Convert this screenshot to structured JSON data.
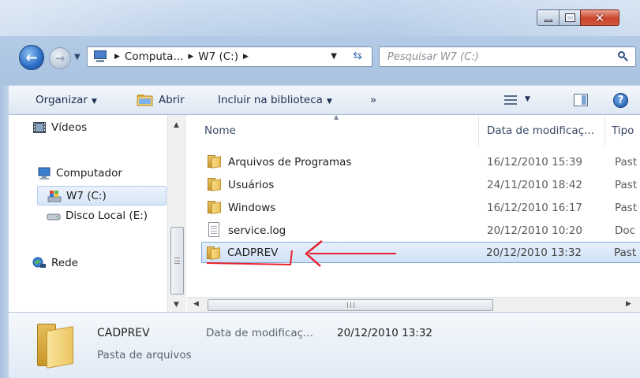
{
  "address": {
    "crumbs": [
      "Computa...",
      "W7 (C:)"
    ],
    "search_placeholder": "Pesquisar W7 (C:)"
  },
  "toolbar": {
    "organize": "Organizar",
    "open": "Abrir",
    "include": "Incluir na biblioteca",
    "more": "»"
  },
  "nav": {
    "videos": "Vídeos",
    "computer": "Computador",
    "w7": "W7 (C:)",
    "local_disk": "Disco Local (E:)",
    "network": "Rede"
  },
  "columns": {
    "name": "Nome",
    "date": "Data de modificaç...",
    "type": "Tipo"
  },
  "files": [
    {
      "name": "Arquivos de Programas",
      "date": "16/12/2010 15:39",
      "type": "Past",
      "icon": "folder"
    },
    {
      "name": "Usuários",
      "date": "24/11/2010 18:42",
      "type": "Past",
      "icon": "folder"
    },
    {
      "name": "Windows",
      "date": "16/12/2010 16:17",
      "type": "Past",
      "icon": "folder"
    },
    {
      "name": "service.log",
      "date": "20/12/2010 10:20",
      "type": "Doc",
      "icon": "document"
    },
    {
      "name": "CADPREV",
      "date": "20/12/2010 13:32",
      "type": "Past",
      "icon": "folder",
      "selected": true
    }
  ],
  "details": {
    "name": "CADPREV",
    "type": "Pasta de arquivos",
    "date_label": "Data de modificaç...",
    "date_value": "20/12/2010 13:32"
  },
  "hscroll_grip": "III",
  "vscroll_grip": "≡",
  "colors": {
    "annotation": "#e8202a",
    "selection": "#cfe1f7",
    "accent": "#2a6cc4"
  }
}
